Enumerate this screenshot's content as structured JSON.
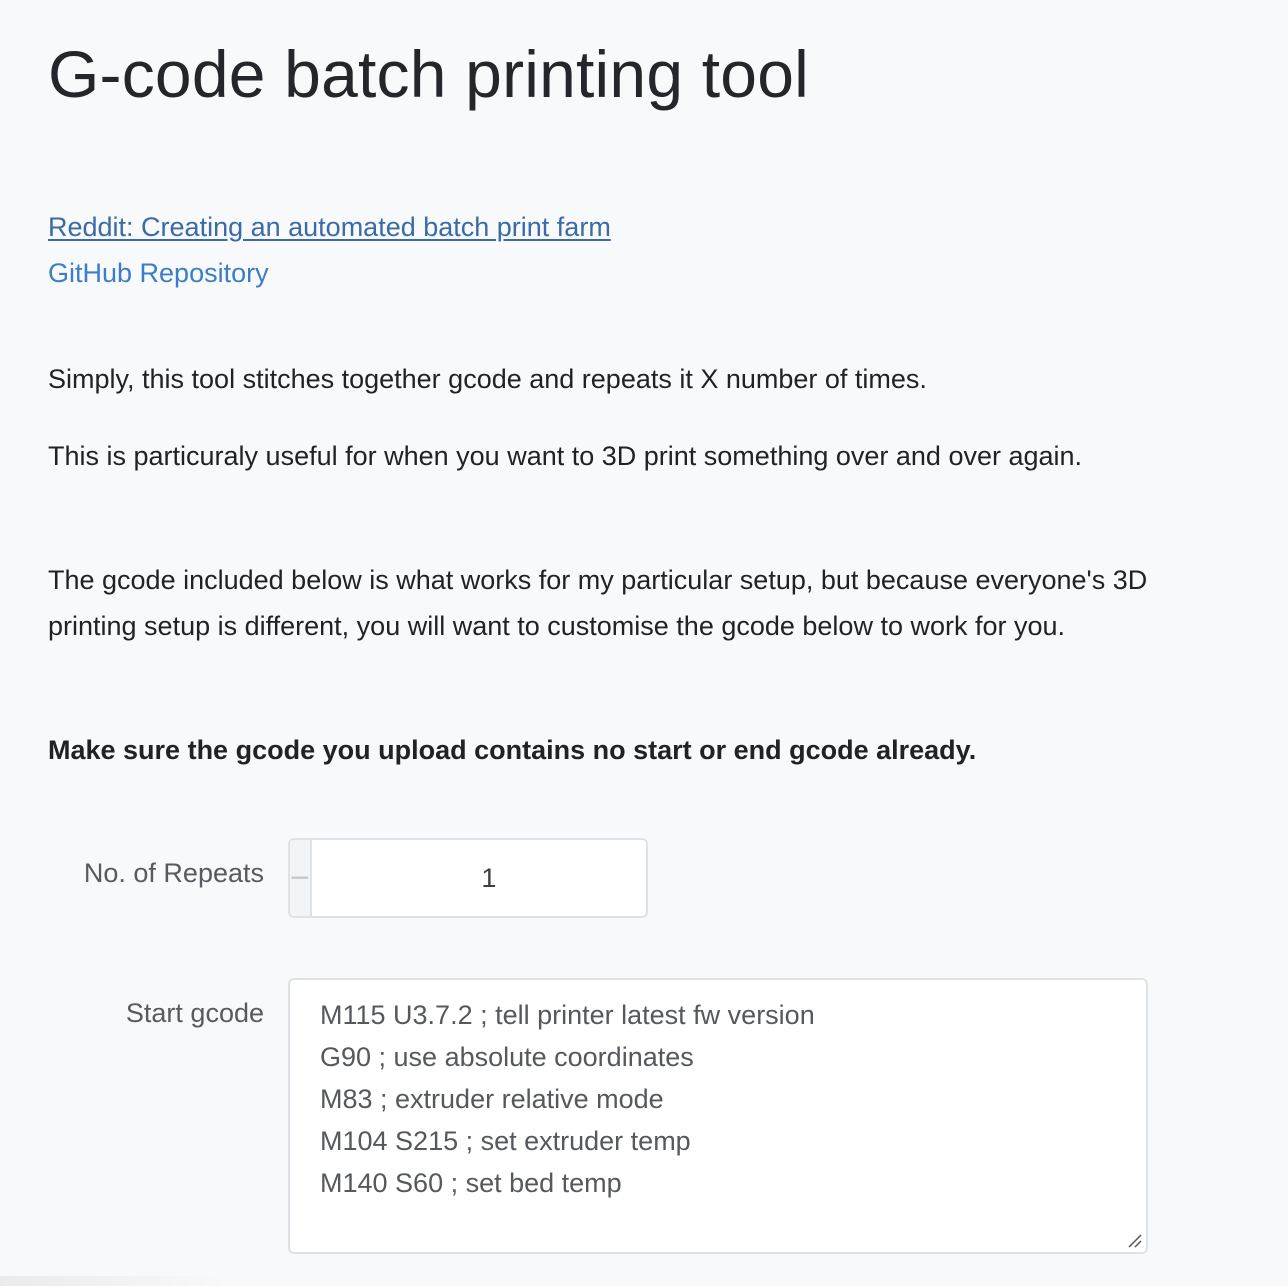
{
  "page": {
    "title": "G-code batch printing tool"
  },
  "links": [
    {
      "label": "Reddit: Creating an automated batch print farm"
    },
    {
      "label": "GitHub Repository"
    }
  ],
  "intro": {
    "p1": "Simply, this tool stitches together gcode and repeats it X number of times.",
    "p2": "This is particuraly useful for when you want to 3D print something over and over again.",
    "p3": "The gcode included below is what works for my particular setup, but because everyone's 3D printing setup is different, you will want to customise the gcode below to work for you.",
    "p4": "Make sure the gcode you upload contains no start or end gcode already."
  },
  "repeats": {
    "label": "No. of Repeats",
    "value": "1",
    "minus_symbol": "−",
    "plus_symbol": "+"
  },
  "start_gcode": {
    "label": "Start gcode",
    "lines": [
      "M115 U3.7.2 ; tell printer latest fw version",
      "G90 ; use absolute coordinates",
      "M83 ; extruder relative mode",
      "M104 S215 ; set extruder temp",
      "M140 S60 ; set bed temp"
    ]
  },
  "colors": {
    "background": "#f8f9fb",
    "link": "#3d7dc8",
    "link_visited": "#3a6ba6"
  }
}
